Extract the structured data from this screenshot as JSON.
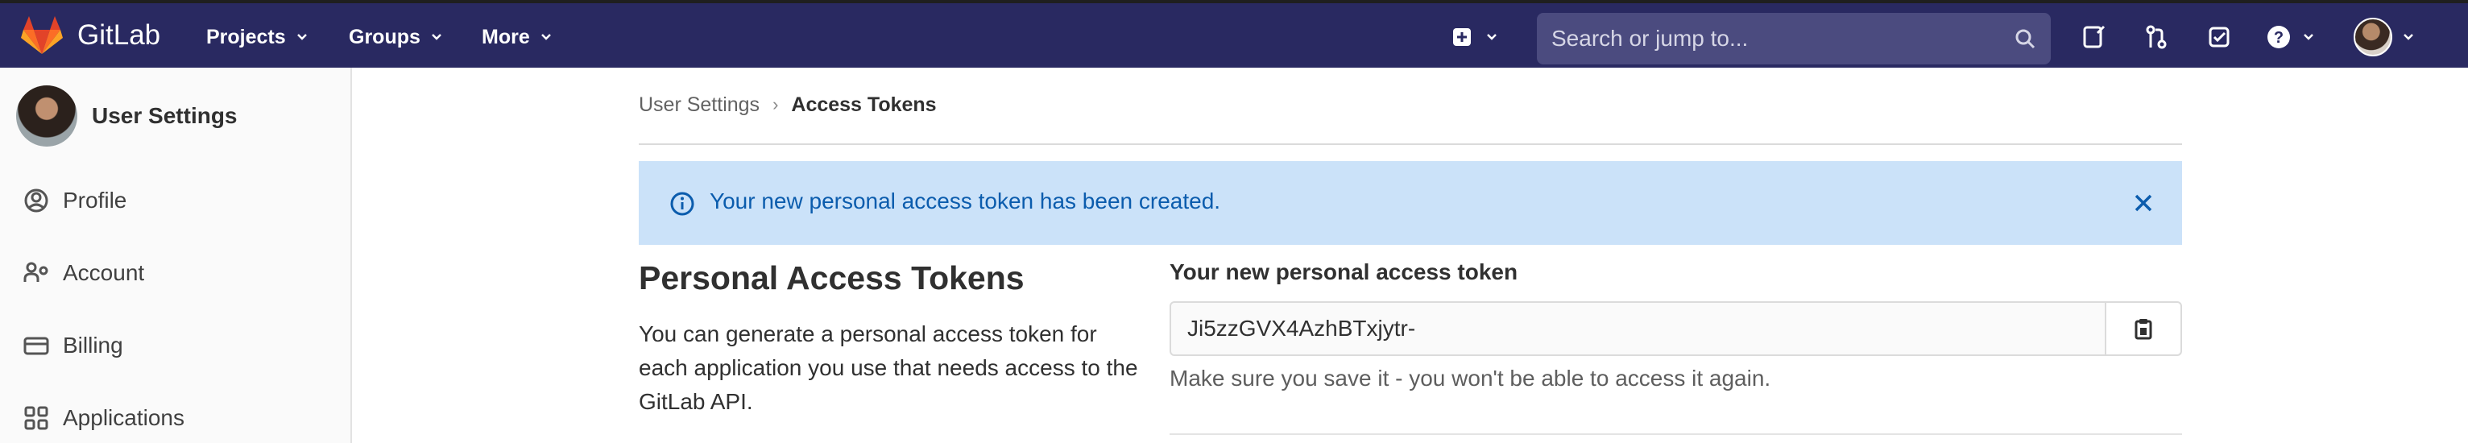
{
  "navbar": {
    "brand": "GitLab",
    "menus": [
      {
        "label": "Projects"
      },
      {
        "label": "Groups"
      },
      {
        "label": "More"
      }
    ],
    "search_placeholder": "Search or jump to...",
    "icons": [
      "plus-square-icon",
      "search-icon",
      "issues-icon",
      "merge-request-icon",
      "todo-icon",
      "help-icon",
      "user-avatar"
    ],
    "color": "#292961"
  },
  "sidebar": {
    "title": "User Settings",
    "items": [
      {
        "label": "Profile",
        "icon": "profile-icon"
      },
      {
        "label": "Account",
        "icon": "account-icon"
      },
      {
        "label": "Billing",
        "icon": "billing-icon"
      },
      {
        "label": "Applications",
        "icon": "applications-icon"
      }
    ]
  },
  "breadcrumb": {
    "parent": "User Settings",
    "current": "Access Tokens"
  },
  "alert": {
    "message": "Your new personal access token has been created.",
    "color": "#cbe2f9"
  },
  "main": {
    "section_title": "Personal Access Tokens",
    "section_description": "You can generate a personal access token for each application you use that needs access to the GitLab API.",
    "token_label": "Your new personal access token",
    "token_value": "Ji5zzGVX4AzhBTxjytr-",
    "token_help": "Make sure you save it - you won't be able to access it again."
  }
}
